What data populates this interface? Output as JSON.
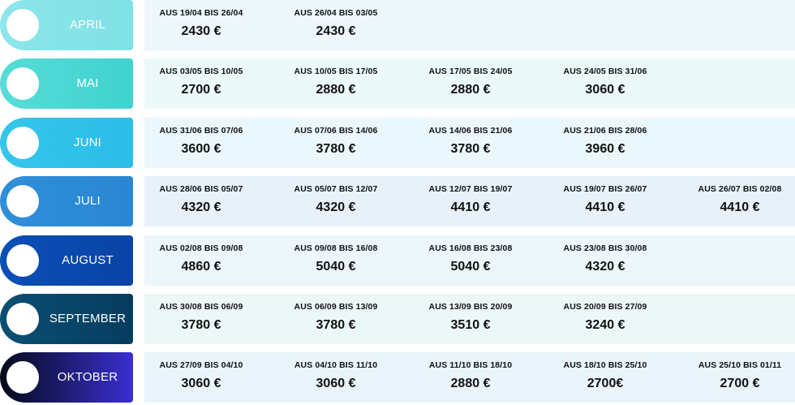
{
  "months": [
    {
      "label": "APRIL",
      "colors": [
        "#8ce6ea",
        "#7fe2e6"
      ],
      "panel": "#eef7fb",
      "weeks": [
        {
          "range": "AUS 19/04 BIS 26/04",
          "price": "2430 €"
        },
        {
          "range": "AUS 26/04 BIS 03/05",
          "price": "2430 €"
        }
      ]
    },
    {
      "label": "MAI",
      "colors": [
        "#58dcd6",
        "#3fd3cf"
      ],
      "panel": "#ebf9f9",
      "weeks": [
        {
          "range": "AUS 03/05 BIS 10/05",
          "price": "2700 €"
        },
        {
          "range": "AUS 10/05 BIS 17/05",
          "price": "2880 €"
        },
        {
          "range": "AUS 17/05 BIS 24/05",
          "price": "2880 €"
        },
        {
          "range": "AUS 24/05 BIS 31/06",
          "price": "3060 €"
        }
      ]
    },
    {
      "label": "JUNI",
      "colors": [
        "#35c6ea",
        "#2cbde8"
      ],
      "panel": "#eaf7fc",
      "weeks": [
        {
          "range": "AUS 31/06 BIS 07/06",
          "price": "3600 €"
        },
        {
          "range": "AUS 07/06 BIS 14/06",
          "price": "3780 €"
        },
        {
          "range": "AUS 14/06 BIS 21/06",
          "price": "3780 €"
        },
        {
          "range": "AUS 21/06 BIS 28/06",
          "price": "3960 €"
        }
      ]
    },
    {
      "label": "JULI",
      "colors": [
        "#2f8fd8",
        "#2a86d2"
      ],
      "panel": "#e8f1fa",
      "weeks": [
        {
          "range": "AUS 28/06 BIS 05/07",
          "price": "4320 €"
        },
        {
          "range": "AUS 05/07 BIS 12/07",
          "price": "4320 €"
        },
        {
          "range": "AUS 12/07 BIS 19/07",
          "price": "4410 €"
        },
        {
          "range": "AUS 19/07 BIS 26/07",
          "price": "4410 €"
        },
        {
          "range": "AUS  26/07  BIS 02/08",
          "price": "4410 €"
        }
      ]
    },
    {
      "label": "AUGUST",
      "colors": [
        "#0b4fb8",
        "#0a44a6"
      ],
      "panel": "#ecf6fb",
      "weeks": [
        {
          "range": "AUS 02/08 BIS 09/08",
          "price": "4860 €"
        },
        {
          "range": "AUS 09/08 BIS 16/08",
          "price": "5040 €"
        },
        {
          "range": "AUS 16/08 BIS 23/08",
          "price": "5040 €"
        },
        {
          "range": "AUS 23/08 BIS 30/08",
          "price": "4320 €"
        }
      ]
    },
    {
      "label": "SEPTEMBER",
      "colors": [
        "#0a4f73",
        "#063c5e"
      ],
      "panel": "#ebf8f7",
      "weeks": [
        {
          "range": "AUS 30/08 BIS 06/09",
          "price": "3780 €"
        },
        {
          "range": "AUS 06/09 BIS 13/09",
          "price": "3780 €"
        },
        {
          "range": "AUS 13/09 BIS 20/09",
          "price": "3510 €"
        },
        {
          "range": "AUS 20/09 BIS 27/09",
          "price": "3240 €"
        }
      ]
    },
    {
      "label": "OKTOBER",
      "colors": [
        "#050a1a",
        "#3a2fd0"
      ],
      "panel": "#eaf4fb",
      "weeks": [
        {
          "range": "AUS 27/09 BIS 04/10",
          "price": "3060 €"
        },
        {
          "range": "AUS 04/10 BIS 11/10",
          "price": "3060 €"
        },
        {
          "range": "AUS 11/10 BIS 18/10",
          "price": "2880 €"
        },
        {
          "range": "AUS 18/10 BIS 25/10",
          "price": "2700€"
        },
        {
          "range": "AUS 25/10 BIS 01/11",
          "price": "2700 €"
        }
      ]
    }
  ]
}
